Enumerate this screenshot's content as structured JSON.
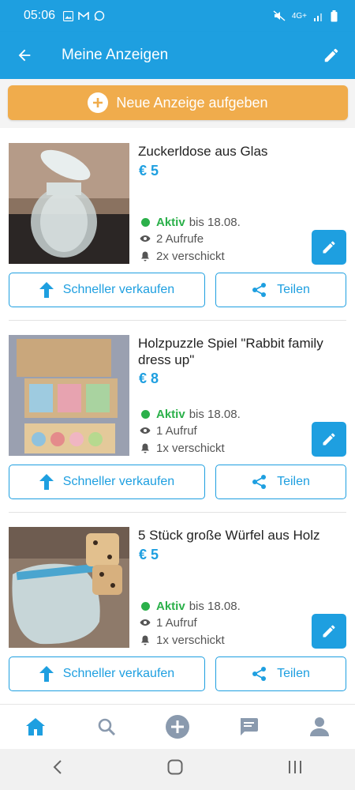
{
  "status_bar": {
    "time": "05:06",
    "network": "4G+"
  },
  "app_bar": {
    "title": "Meine Anzeigen"
  },
  "new_ad": {
    "label": "Neue Anzeige aufgeben"
  },
  "listings": [
    {
      "title": "Zuckerldose aus Glas",
      "price": "€ 5",
      "status": "Aktiv",
      "until": "bis 18.08.",
      "views": "2 Aufrufe",
      "sent": "2x verschickt",
      "boost_label": "Schneller verkaufen",
      "share_label": "Teilen"
    },
    {
      "title": "Holzpuzzle Spiel \"Rabbit family dress up\"",
      "price": "€ 8",
      "status": "Aktiv",
      "until": "bis 18.08.",
      "views": "1 Aufruf",
      "sent": "1x verschickt",
      "boost_label": "Schneller verkaufen",
      "share_label": "Teilen"
    },
    {
      "title": "5 Stück große Würfel aus Holz",
      "price": "€ 5",
      "status": "Aktiv",
      "until": "bis 18.08.",
      "views": "1 Aufruf",
      "sent": "1x verschickt",
      "boost_label": "Schneller verkaufen",
      "share_label": "Teilen"
    }
  ],
  "colors": {
    "primary": "#1e9fe0",
    "accent": "#f0ac4c",
    "active": "#2bb04a"
  },
  "bottom_nav": [
    "home-icon",
    "search-icon",
    "add-icon",
    "messages-icon",
    "profile-icon"
  ]
}
